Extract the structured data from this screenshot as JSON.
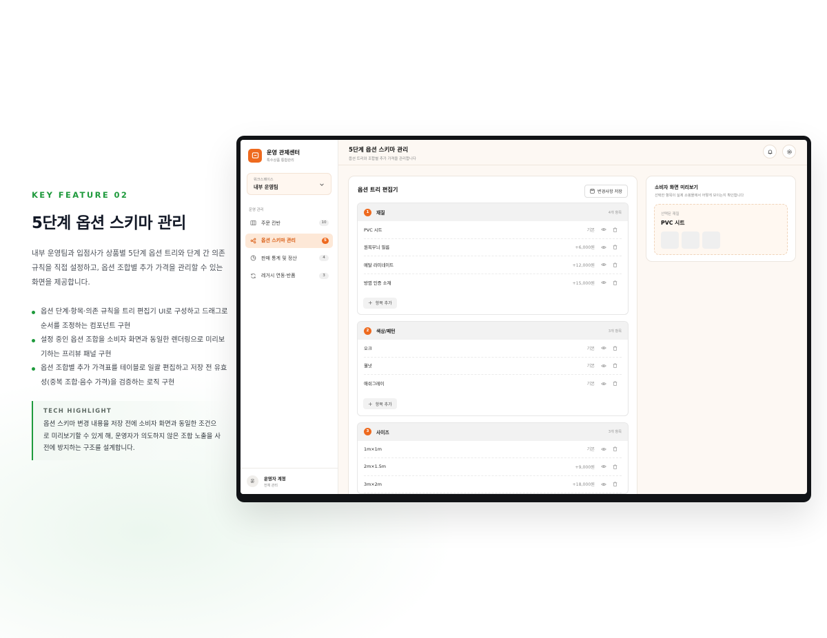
{
  "feature": {
    "kicker": "KEY FEATURE 02",
    "title": "5단계 옵션 스키마 관리",
    "description": "내부 운영팀과 입점사가 상품별 5단계 옵션 트리와 단계 간 의존 규칙을 직접 설정하고, 옵션 조합별 추가 가격을 관리할 수 있는 화면을 제공합니다.",
    "bullets": [
      "옵션 단계·항목·의존 규칙을 트리 편집기 UI로 구성하고 드래그로 순서를 조정하는 컴포넌트 구현",
      "설정 중인 옵션 조합을 소비자 화면과 동일한 렌더링으로 미리보기하는 프리뷰 패널 구현",
      "옵션 조합별 추가 가격표를 테이블로 일괄 편집하고 저장 전 유효성(중복 조합·음수 가격)을 검증하는 로직 구현"
    ],
    "tech_kicker": "TECH HIGHLIGHT",
    "tech_text": "옵션 스키마 변경 내용을 저장 전에 소비자 화면과 동일한 조건으로 미리보기할 수 있게 해, 운영자가 의도하지 않은 조합 노출을 사전에 방지하는 구조를 설계합니다."
  },
  "app": {
    "brand_name": "운영 관제센터",
    "brand_sub": "특수상품 통합관리",
    "workspace_label": "워크스페이스",
    "workspace_value": "내부 운영팀",
    "nav_section": "운영 관리",
    "nav": [
      {
        "label": "주문 칸반",
        "badge": "10"
      },
      {
        "label": "옵션 스키마 관리",
        "badge": "5"
      },
      {
        "label": "판매 통계 및 정산",
        "badge": "4"
      },
      {
        "label": "레거시 연동·반품",
        "badge": "3"
      }
    ],
    "user_avatar": "운",
    "user_name": "운영자 계정",
    "user_role": "전체 관리",
    "page_title": "5단계 옵션 스키마 관리",
    "page_sub": "옵션 트리와 조합별 추가 가격을 관리합니다",
    "editor_title": "옵션 트리 편집기",
    "save_label": "변경사항 저장",
    "add_label": "항목 추가",
    "groups": [
      {
        "num": "1",
        "name": "재질",
        "count": "4개 항목",
        "options": [
          {
            "name": "PVC 시트",
            "price": "기본"
          },
          {
            "name": "원목무늬 필름",
            "price": "+6,000원"
          },
          {
            "name": "메탈 라미네이트",
            "price": "+12,000원"
          },
          {
            "name": "방염 인증 소재",
            "price": "+15,000원"
          }
        ]
      },
      {
        "num": "2",
        "name": "색상/패턴",
        "count": "3개 항목",
        "options": [
          {
            "name": "오크",
            "price": "기본"
          },
          {
            "name": "월넛",
            "price": "기본"
          },
          {
            "name": "애쉬그레이",
            "price": "기본"
          }
        ]
      },
      {
        "num": "3",
        "name": "사이즈",
        "count": "3개 항목",
        "options": [
          {
            "name": "1m×1m",
            "price": "기본"
          },
          {
            "name": "2m×1.5m",
            "price": "+9,000원"
          },
          {
            "name": "3m×2m",
            "price": "+18,000원"
          }
        ]
      }
    ],
    "preview_title": "소비자 화면 미리보기",
    "preview_sub": "선택한 항목이 실제 쇼핑몰에서 어떻게 보이는지 확인합니다",
    "preview_label": "선택된 재질",
    "preview_value": "PVC 시트"
  },
  "colors": {
    "accent": "#ee6a1f",
    "green": "#1e9a3c"
  }
}
